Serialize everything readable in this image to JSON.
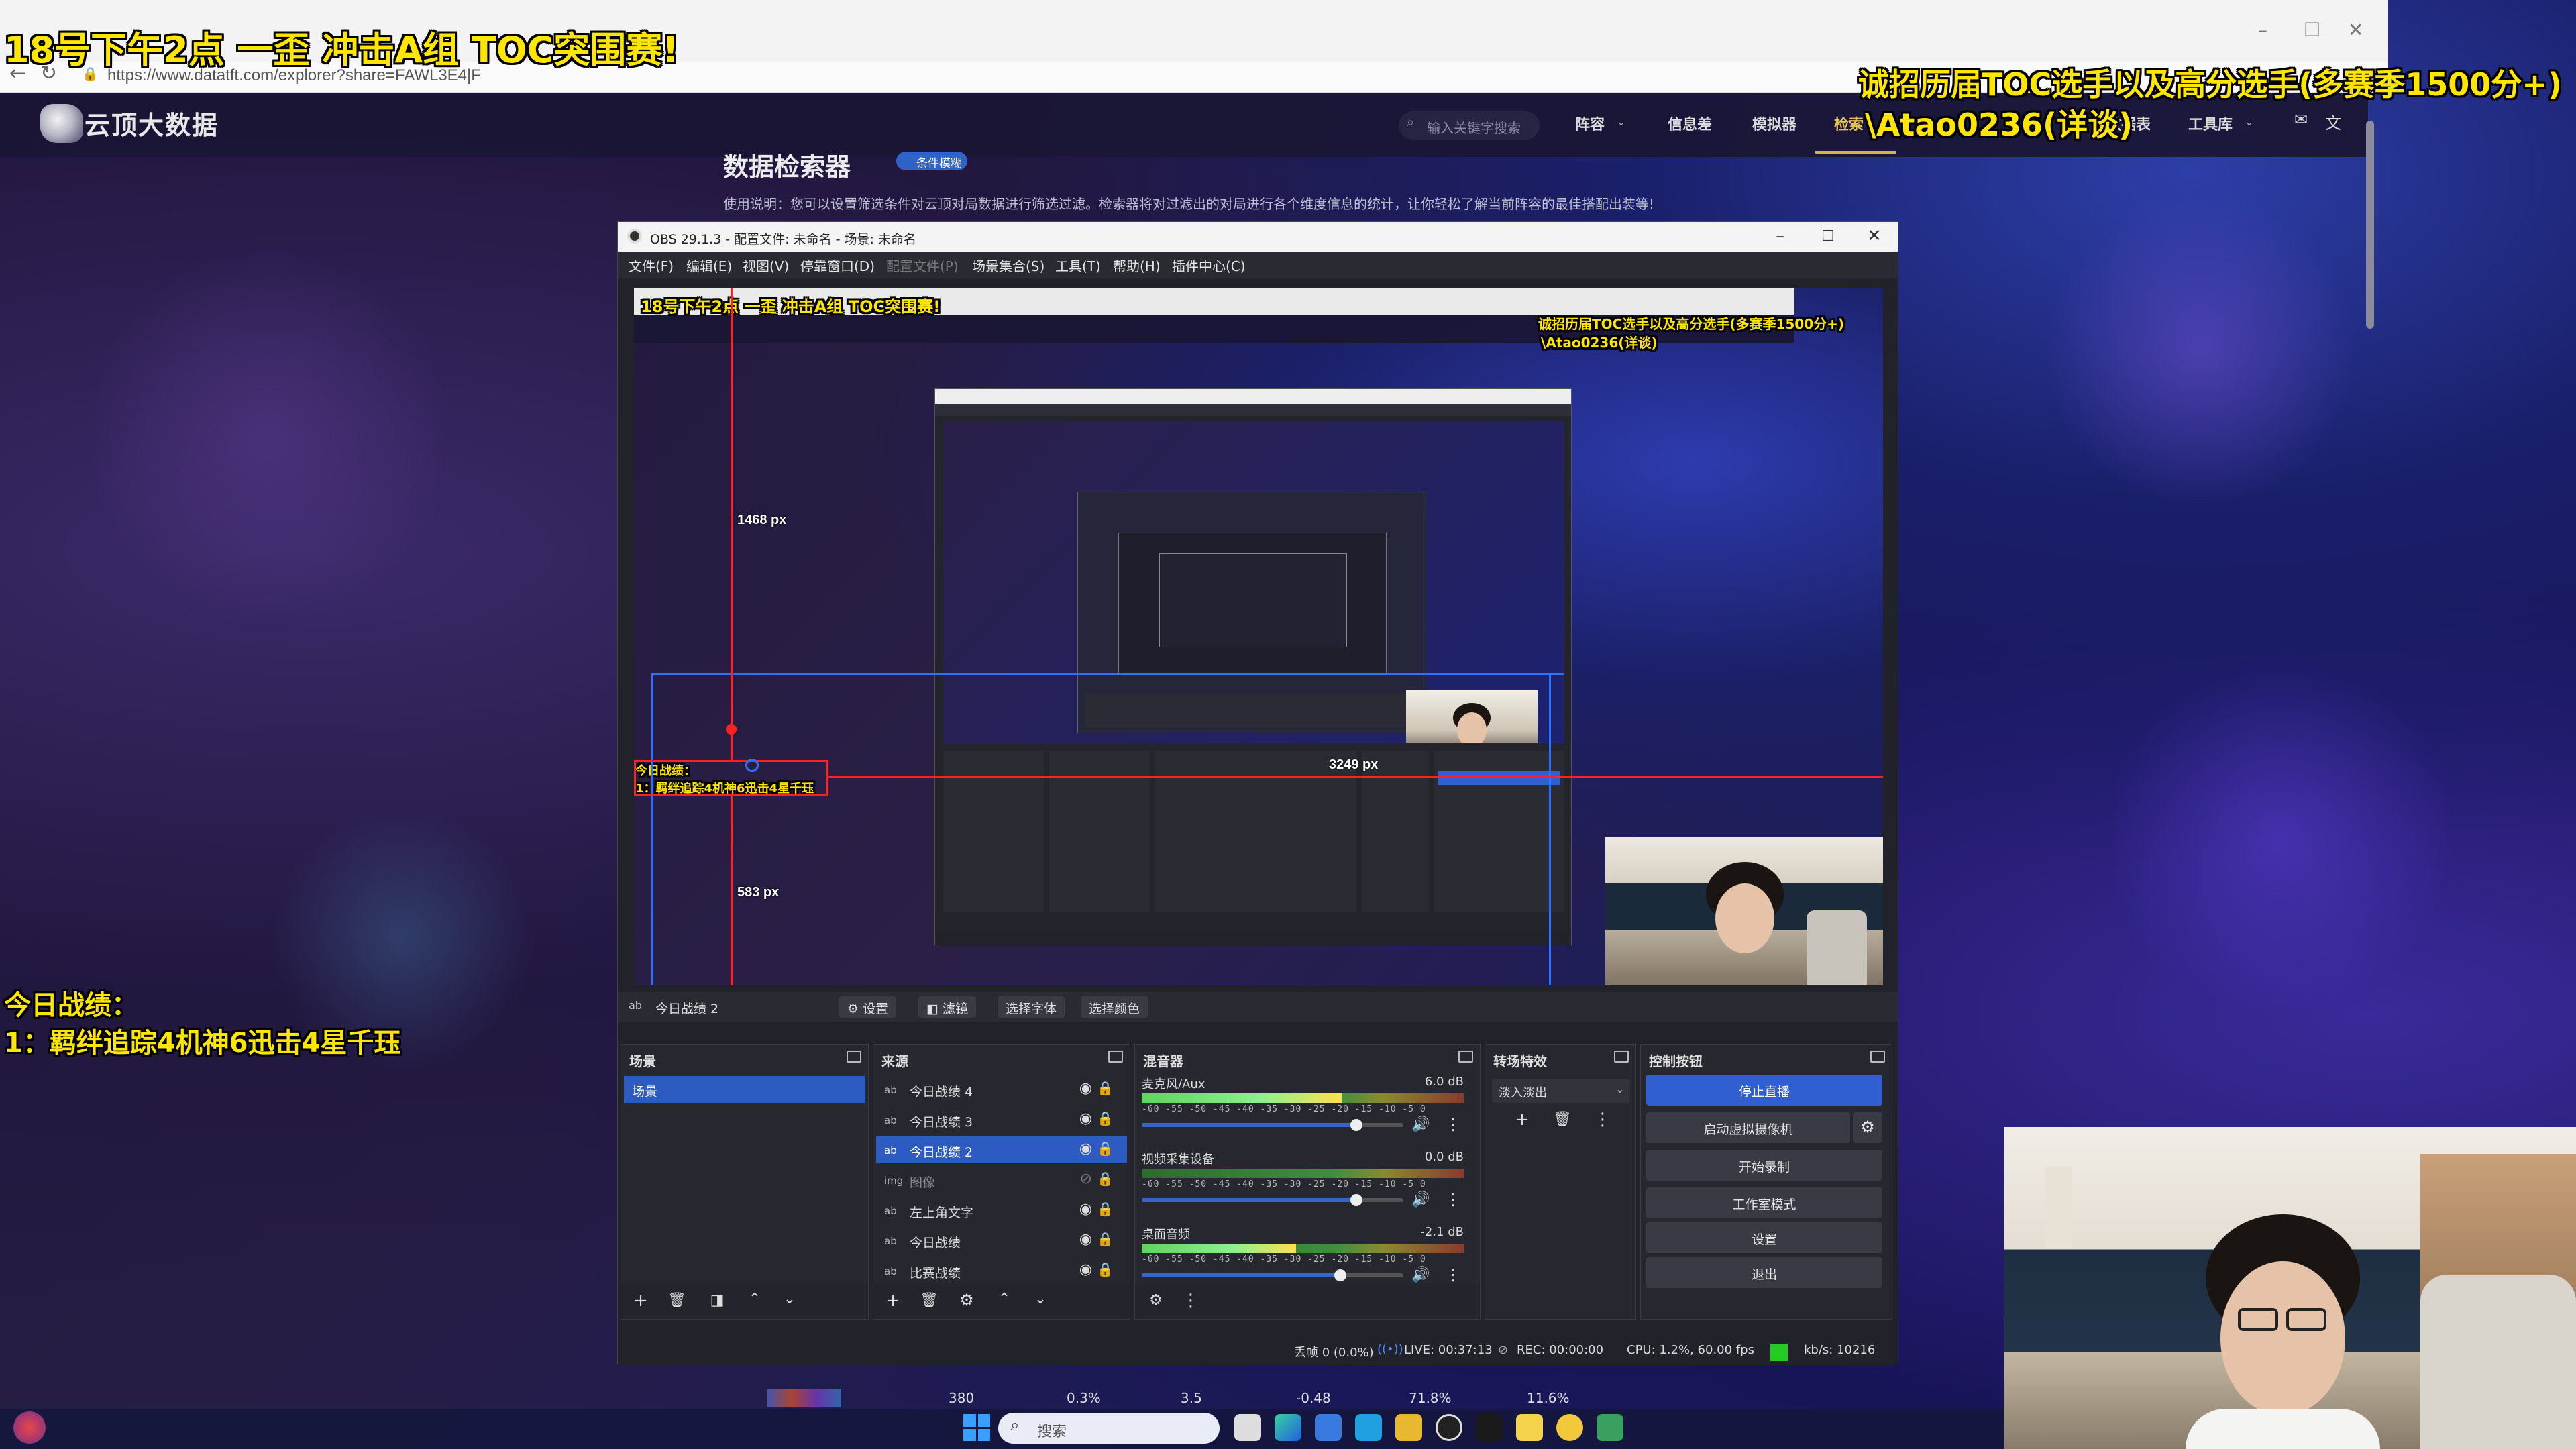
{
  "overlay": {
    "title": "18号下午2点 一歪 冲击A组 TOC突围赛!",
    "recruit_line1": "诚招历届TOC选手以及高分选手(多赛季1500分+)",
    "recruit_line2": "\\Atao0236(详谈)",
    "record_heading": "今日战绩：",
    "record_value": "1：羁绊追踪4机神6迅击4星千珏"
  },
  "browser": {
    "url": "https://www.datatft.com/explorer?share=FAWL3E4|F",
    "back_icon": "←",
    "reload_icon": "↻",
    "lock_icon": "🔒"
  },
  "site": {
    "name": "云顶大数据",
    "search_placeholder": "输入关键字搜索",
    "nav": [
      "阵容",
      "信息差",
      "模拟器",
      "检索",
      "数据表",
      "工具库"
    ],
    "heading": "数据检索器",
    "heading_badge": "条件模糊",
    "description": "使用说明：您可以设置筛选条件对云顶对局数据进行筛选过滤。检索器将对过滤出的对局进行各个维度信息的统计，让你轻松了解当前阵容的最佳搭配出装等!"
  },
  "obs": {
    "title": "OBS 29.1.3 - 配置文件: 未命名 - 场景: 未命名",
    "menu": [
      "文件(F)",
      "编辑(E)",
      "视图(V)",
      "停靠窗口(D)",
      "配置文件(P)",
      "场景集合(S)",
      "工具(T)",
      "帮助(H)",
      "插件中心(C)"
    ],
    "measure": {
      "top": "1468 px",
      "right": "3249 px",
      "bottom": "583 px"
    },
    "selected_source": "今日战绩 2",
    "source_toolbar": {
      "settings": "设置",
      "filters": "滤镜",
      "font": "选择字体",
      "color": "选择颜色"
    },
    "scenes": {
      "title": "场景",
      "items": [
        "场景"
      ]
    },
    "sources": {
      "title": "来源",
      "items": [
        {
          "name": "今日战绩 4",
          "icon": "ab"
        },
        {
          "name": "今日战绩 3",
          "icon": "ab"
        },
        {
          "name": "今日战绩 2",
          "icon": "ab"
        },
        {
          "name": "图像",
          "icon": "img"
        },
        {
          "name": "左上角文字",
          "icon": "ab"
        },
        {
          "name": "今日战绩",
          "icon": "ab"
        },
        {
          "name": "比赛战绩",
          "icon": "ab"
        }
      ]
    },
    "mixer": {
      "title": "混音器",
      "ticks": "-60 -55 -50 -45 -40 -35 -30 -25 -20 -15 -10 -5 0",
      "channels": [
        {
          "name": "麦克风/Aux",
          "db": "6.0 dB",
          "level": 0.62,
          "volume": 0.82
        },
        {
          "name": "视频采集设备",
          "db": "0.0 dB",
          "level": 0.0,
          "volume": 0.82
        },
        {
          "name": "桌面音频",
          "db": "-2.1 dB",
          "level": 0.48,
          "volume": 0.76
        }
      ]
    },
    "transitions": {
      "title": "转场特效",
      "selected": "淡入淡出"
    },
    "controls": {
      "title": "控制按钮",
      "buttons": [
        "停止直播",
        "启动虚拟摄像机",
        "开始录制",
        "工作室模式",
        "设置",
        "退出"
      ]
    },
    "status": {
      "dropped": "丢帧 0 (0.0%)",
      "live": "LIVE: 00:37:13",
      "rec": "REC: 00:00:00",
      "cpu": "CPU: 1.2%, 60.00 fps",
      "kbps": "kb/s: 10216"
    }
  },
  "taskbar": {
    "search_placeholder": "搜索",
    "strip_values": [
      "380",
      "0.3%",
      "3.5",
      "-0.48",
      "71.8%",
      "11.6%"
    ]
  }
}
